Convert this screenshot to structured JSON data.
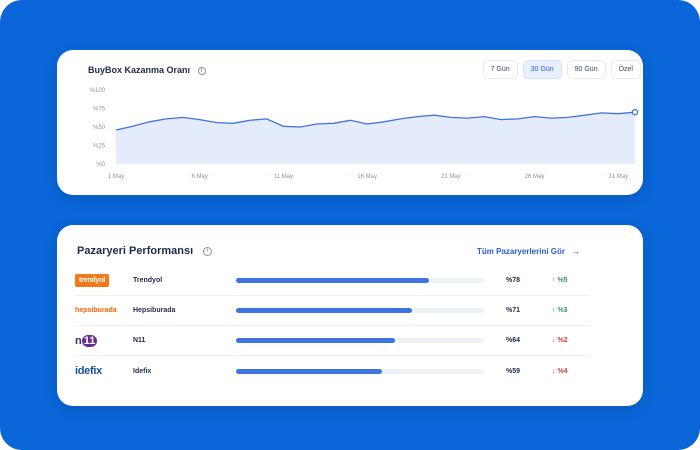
{
  "chart_card": {
    "title": "BuyBox Kazanma Oranı",
    "ranges": [
      {
        "label": "7 Gün",
        "active": false
      },
      {
        "label": "30 Gün",
        "active": true
      },
      {
        "label": "90 Gün",
        "active": false
      },
      {
        "label": "Özel",
        "active": false
      }
    ]
  },
  "chart_data": {
    "type": "area",
    "x": [
      "1 May",
      "2 May",
      "3 May",
      "4 May",
      "5 May",
      "6 May",
      "7 May",
      "8 May",
      "9 May",
      "10 May",
      "11 May",
      "12 May",
      "13 May",
      "14 May",
      "15 May",
      "16 May",
      "17 May",
      "18 May",
      "19 May",
      "20 May",
      "21 May",
      "22 May",
      "23 May",
      "24 May",
      "25 May",
      "26 May",
      "27 May",
      "28 May",
      "29 May",
      "30 May",
      "31 May",
      "1 Jun"
    ],
    "values": [
      46,
      51,
      57,
      61,
      63,
      60,
      56,
      55,
      59,
      61,
      51,
      50,
      54,
      55,
      59,
      54,
      57,
      61,
      64,
      66,
      63,
      62,
      64,
      60,
      61,
      64,
      62,
      63,
      66,
      69,
      68,
      70
    ],
    "x_tick_labels": [
      "1 May",
      "6 May",
      "11 May",
      "16 May",
      "21 May",
      "26 May",
      "31 May"
    ],
    "y_tick_labels": [
      "%100",
      "%75",
      "%50",
      "%25",
      "%0"
    ],
    "ylim": [
      0,
      100
    ],
    "grid": false,
    "line_color": "#3e74e0",
    "fill_color": "#dfe9fb"
  },
  "perf_card": {
    "title": "Pazaryeri Performansı",
    "see_all": "Tüm Pazaryerlerini Gör",
    "rows": [
      {
        "logo": "trendyol",
        "name": "Trendyol",
        "value": 78,
        "pct": "%78",
        "delta": "%5",
        "dir": "up"
      },
      {
        "logo": "hepsiburada",
        "name": "Hepsiburada",
        "value": 71,
        "pct": "%71",
        "delta": "%3",
        "dir": "up"
      },
      {
        "logo": "n11",
        "name": "N11",
        "value": 64,
        "pct": "%64",
        "delta": "%2",
        "dir": "down"
      },
      {
        "logo": "idefix",
        "name": "Idefix",
        "value": 59,
        "pct": "%59",
        "delta": "%4",
        "dir": "down"
      }
    ]
  },
  "icons": {
    "up": "↑",
    "down": "↓",
    "arrow_right": "→",
    "info": "i"
  },
  "colors": {
    "background": "#0a66d8",
    "accent": "#3e74e0",
    "up": "#2f9e54",
    "down": "#d64545"
  }
}
